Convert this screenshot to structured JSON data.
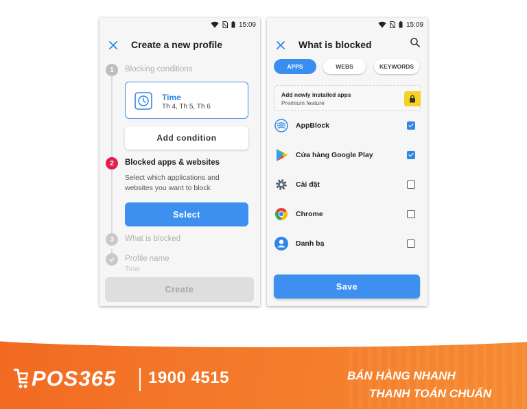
{
  "status_bar": {
    "time": "15:09"
  },
  "profile_screen": {
    "title": "Create a new profile",
    "steps": [
      {
        "number": "1",
        "label": "Blocking conditions"
      },
      {
        "number": "2",
        "label": "Blocked apps & websites"
      },
      {
        "number": "3",
        "label": "What is blocked"
      },
      {
        "number": "",
        "label": "Profile name"
      }
    ],
    "condition_card": {
      "title": "Time",
      "subtitle": "Th 4, Th 5, Th 6"
    },
    "add_condition_label": "Add condition",
    "step2_description": "Select which applications and websites you want to block",
    "select_label": "Select",
    "profile_name_value": "Time",
    "create_label": "Create"
  },
  "blocked_screen": {
    "title": "What is blocked",
    "tabs": [
      {
        "label": "APPS",
        "active": true
      },
      {
        "label": "WEBS",
        "active": false
      },
      {
        "label": "KEYWORDS",
        "active": false
      }
    ],
    "premium_box": {
      "title": "Add newly installed apps",
      "subtitle": "Premium feature"
    },
    "apps": [
      {
        "name": "AppBlock",
        "checked": true,
        "icon": "appblock-icon"
      },
      {
        "name": "Cửa hàng Google Play",
        "checked": true,
        "icon": "google-play-icon"
      },
      {
        "name": "Cài đặt",
        "checked": false,
        "icon": "settings-gear-icon"
      },
      {
        "name": "Chrome",
        "checked": false,
        "icon": "chrome-icon"
      },
      {
        "name": "Danh bạ",
        "checked": false,
        "icon": "contacts-icon"
      }
    ],
    "save_label": "Save"
  },
  "banner": {
    "logo_text": "POS365",
    "hotline": "1900 4515",
    "slogan_line1": "BÁN HÀNG NHANH",
    "slogan_line2": "THANH TOÁN CHUẨN"
  },
  "colors": {
    "accent_blue": "#3d8ff0",
    "step_active_red": "#e0224a",
    "banner_orange": "#f26a22"
  }
}
